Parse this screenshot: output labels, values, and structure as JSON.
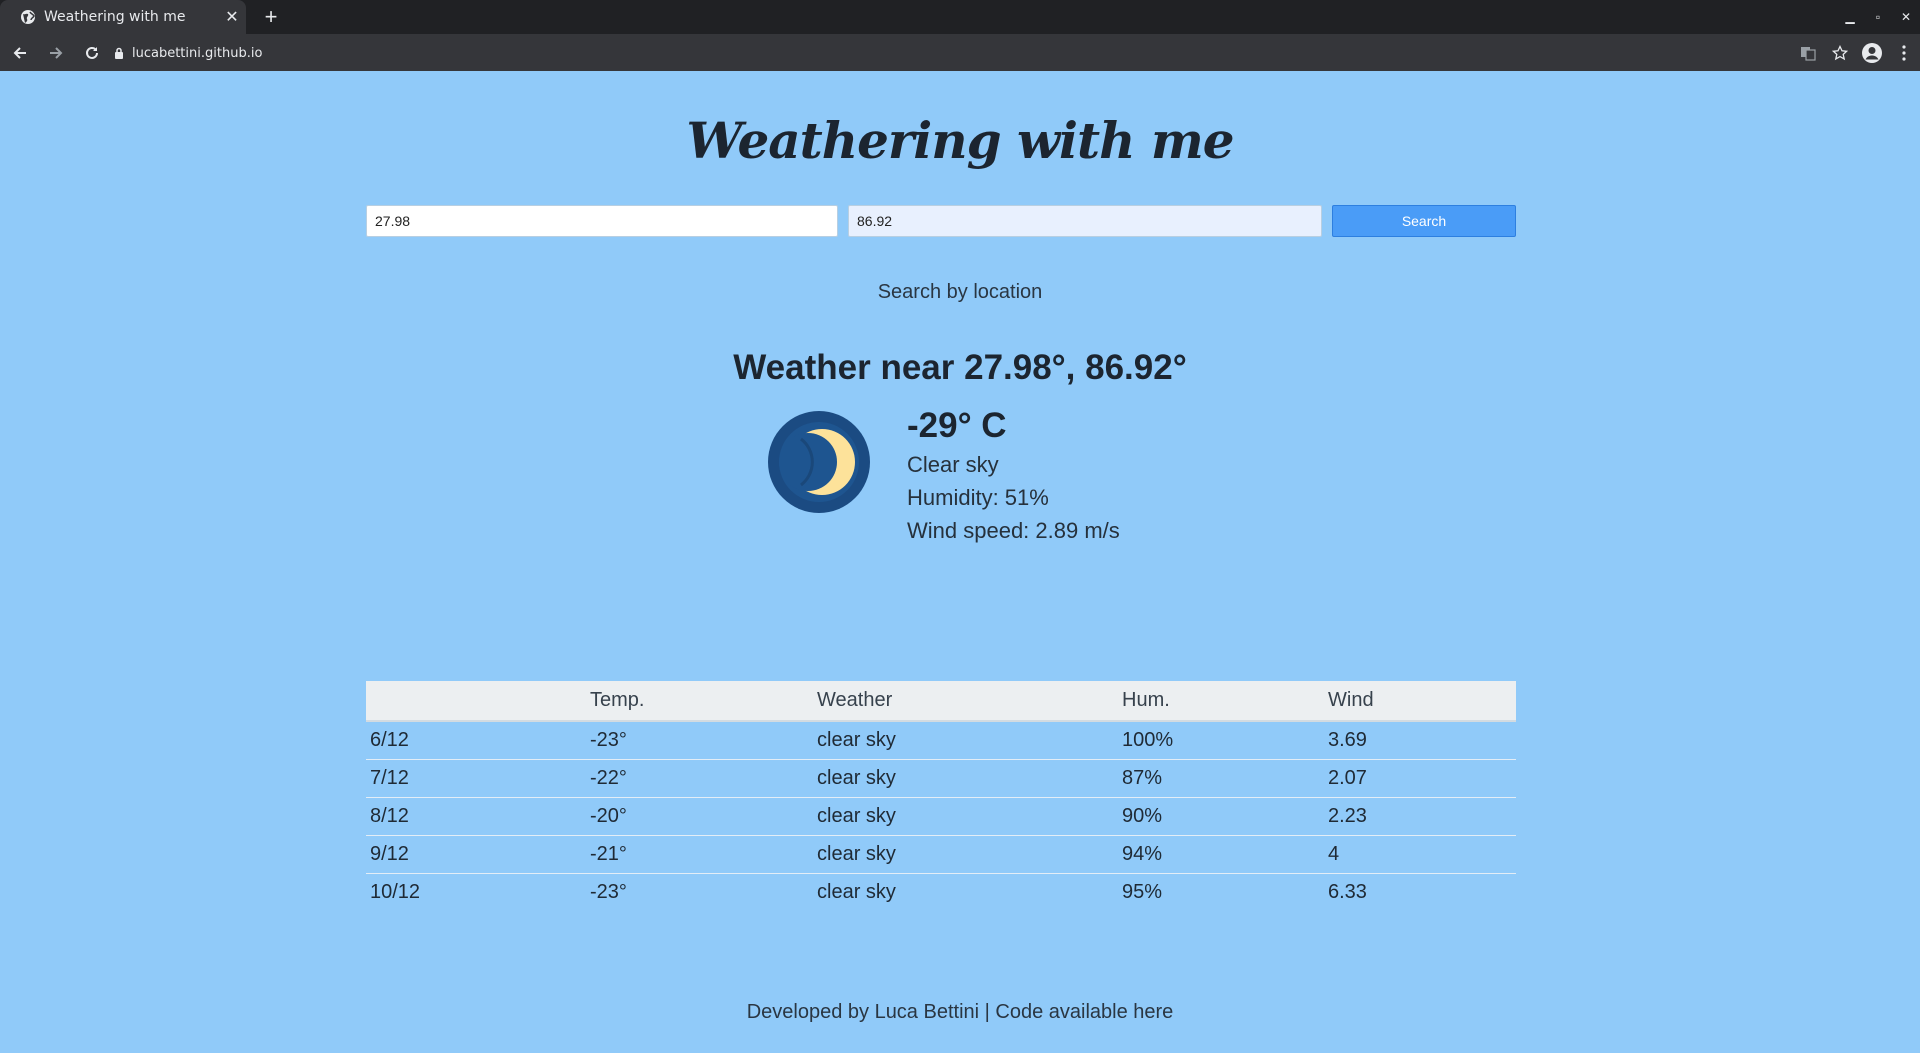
{
  "browser": {
    "tab_title": "Weathering with me",
    "url": "lucabettini.github.io"
  },
  "page": {
    "title": "Weathering with me",
    "search": {
      "latitude_value": "27.98",
      "longitude_value": "86.92",
      "button_label": "Search"
    },
    "search_by_location_label": "Search by location",
    "weather_heading": "Weather near 27.98°, 86.92°",
    "current": {
      "icon": "moon-icon",
      "temperature": "-29° C",
      "description": "Clear sky",
      "humidity": "Humidity: 51%",
      "wind": "Wind speed: 2.89 m/s"
    },
    "forecast": {
      "headers": [
        "",
        "Temp.",
        "Weather",
        "Hum.",
        "Wind"
      ],
      "rows": [
        [
          "6/12",
          "-23°",
          "clear sky",
          "100%",
          "3.69"
        ],
        [
          "7/12",
          "-22°",
          "clear sky",
          "87%",
          "2.07"
        ],
        [
          "8/12",
          "-20°",
          "clear sky",
          "90%",
          "2.23"
        ],
        [
          "9/12",
          "-21°",
          "clear sky",
          "94%",
          "4"
        ],
        [
          "10/12",
          "-23°",
          "clear sky",
          "95%",
          "6.33"
        ]
      ]
    },
    "footer": "Developed by Luca Bettini | Code available here"
  },
  "colors": {
    "page_background": "#90CAF9",
    "button": "#4a9cf7",
    "moon_ring": "#1d4f86",
    "moon_yellow": "#fde29a"
  }
}
